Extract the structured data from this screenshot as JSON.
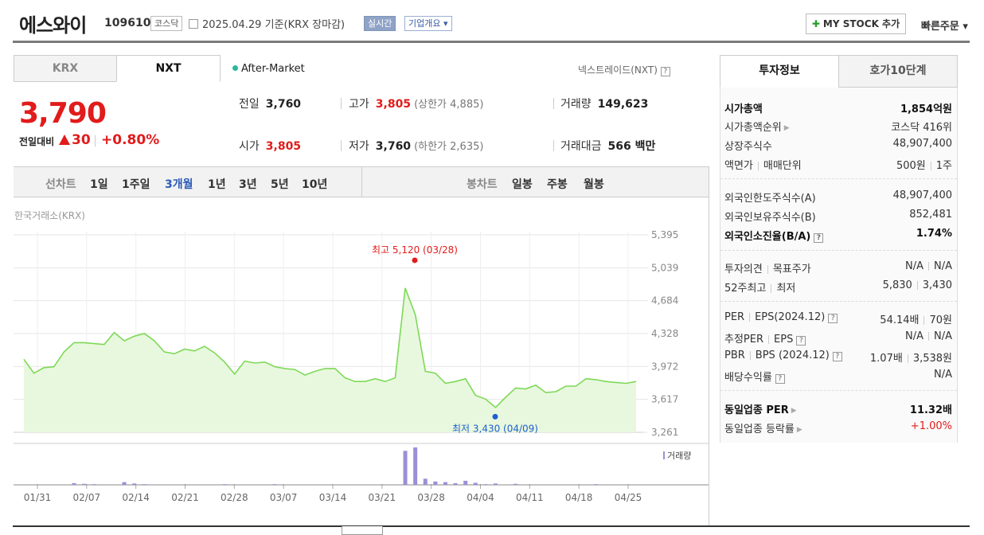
{
  "header": {
    "title": "에스와이",
    "code": "109610",
    "market_chip": "코스닥",
    "date": "2025.04.29",
    "basis": "기준(KRX 장마감)",
    "realtime_chip": "실시간",
    "company_chip": "기업개요 ▾",
    "mystock_label": "MY STOCK 추가",
    "quick_order_label": "빠른주문 ▾"
  },
  "market_tabs": {
    "krx": "KRX",
    "nxt": "NXT"
  },
  "after_market": "After-Market",
  "nxt_name": "넥스트레이드(NXT)",
  "price": {
    "current": "3,790",
    "change_label": "전일대비",
    "change": "30",
    "change_pct": "+0.80%",
    "prev_label": "전일",
    "prev": "3,760",
    "high_label": "고가",
    "high": "3,805",
    "upper_limit": "(상한가 4,885)",
    "volume_label": "거래량",
    "volume": "149,623",
    "open_label": "시가",
    "open": "3,805",
    "low_label": "저가",
    "low": "3,760",
    "lower_limit": "(하한가 2,635)",
    "amount_label": "거래대금",
    "amount": "566 백만"
  },
  "periods": {
    "line_label": "선차트",
    "line_items": [
      "1일",
      "1주일",
      "3개월",
      "1년",
      "3년",
      "5년",
      "10년"
    ],
    "active": "3개월",
    "candle_label": "봉차트",
    "candle_items": [
      "일봉",
      "주봉",
      "월봉"
    ]
  },
  "chart_exchange_label": "한국거래소(KRX)",
  "chart_data": {
    "type": "area",
    "y_ticks": [
      "5,395",
      "5,039",
      "4,684",
      "4,328",
      "3,972",
      "3,617",
      "3,261"
    ],
    "ylim": [
      3261,
      5395
    ],
    "x_ticks": [
      "01/31",
      "02/07",
      "02/14",
      "02/21",
      "02/28",
      "03/07",
      "03/14",
      "03/21",
      "03/28",
      "04/04",
      "04/11",
      "04/18",
      "04/25"
    ],
    "values": [
      4050,
      3900,
      3960,
      3970,
      4130,
      4230,
      4230,
      4220,
      4210,
      4340,
      4250,
      4300,
      4330,
      4250,
      4130,
      4110,
      4160,
      4140,
      4190,
      4120,
      4020,
      3890,
      4030,
      4010,
      4020,
      3970,
      3950,
      3940,
      3880,
      3920,
      3950,
      3950,
      3850,
      3810,
      3810,
      3840,
      3810,
      3850,
      4820,
      4530,
      3920,
      3900,
      3790,
      3810,
      3840,
      3660,
      3620,
      3530,
      3640,
      3740,
      3730,
      3770,
      3690,
      3700,
      3760,
      3760,
      3840,
      3830,
      3810,
      3800,
      3790,
      3810
    ],
    "volume": [
      0,
      0,
      0,
      0,
      0,
      5,
      3,
      2,
      0,
      0,
      8,
      4,
      2,
      0,
      0,
      0,
      0,
      0,
      0,
      0,
      2,
      0,
      0,
      0,
      0,
      2,
      0,
      0,
      0,
      0,
      0,
      0,
      0,
      0,
      0,
      0,
      0,
      0,
      100,
      110,
      18,
      10,
      8,
      5,
      12,
      6,
      2,
      4,
      0,
      3,
      0,
      0,
      0,
      0,
      0,
      0,
      0,
      2,
      0,
      0,
      0,
      0
    ],
    "high_label": "최고 5,120 (03/28)",
    "high_value": 5120,
    "low_label": "최저 3,430 (04/09)",
    "low_value": 3430,
    "volume_legend": "거래량",
    "line_color": "#7ed957",
    "fill_color": "#e8f8de",
    "volume_color": "#9b8fd6"
  },
  "right_tabs": {
    "invest": "투자정보",
    "order": "호가10단계"
  },
  "invest": {
    "market_cap_label": "시가총액",
    "market_cap": "1,854억원",
    "rank_label": "시가총액순위",
    "rank": "코스닥 416위",
    "shares_label": "상장주식수",
    "shares": "48,907,400",
    "par_label": "액면가",
    "unit_label": "매매단위",
    "par": "500원",
    "unit": "1주",
    "foreign_limit_label": "외국인한도주식수(A)",
    "foreign_limit": "48,907,400",
    "foreign_hold_label": "외국인보유주식수(B)",
    "foreign_hold": "852,481",
    "foreign_ratio_label": "외국인소진율(B/A)",
    "foreign_ratio": "1.74%",
    "opinion_label": "투자의견",
    "target_label": "목표주가",
    "opinion": "N/A",
    "target": "N/A",
    "w52_high_label": "52주최고",
    "w52_low_label": "최저",
    "w52_high": "5,830",
    "w52_low": "3,430",
    "per_label": "PER",
    "eps_label": "EPS",
    "eps_date": "(2024.12)",
    "per": "54.14배",
    "eps": "70원",
    "est_per_label": "추정PER",
    "est_eps_label": "EPS",
    "est_per": "N/A",
    "est_eps": "N/A",
    "pbr_label": "PBR",
    "bps_label": "BPS",
    "bps_date": "(2024.12)",
    "pbr": "1.07배",
    "bps": "3,538원",
    "div_label": "배당수익률",
    "div": "N/A",
    "sector_per_label": "동일업종 PER",
    "sector_per": "11.32배",
    "sector_rate_label": "동일업종 등락률",
    "sector_rate": "+1.00%"
  }
}
